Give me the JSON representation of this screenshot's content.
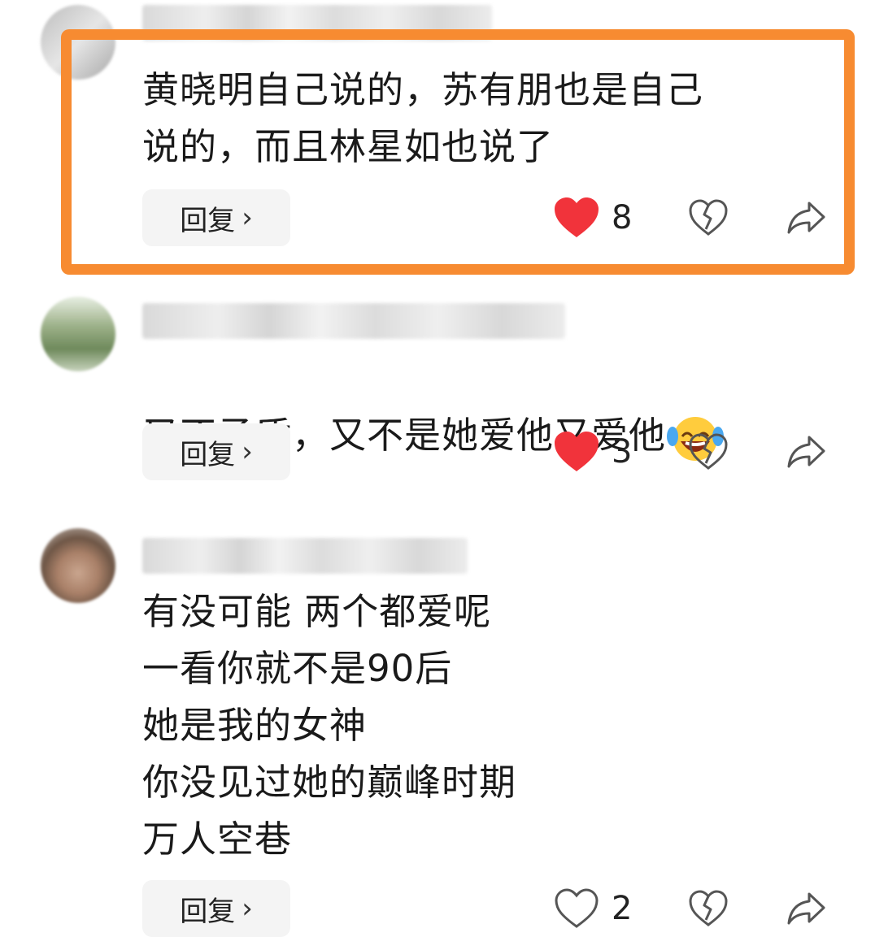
{
  "comments": [
    {
      "text": "黄晓明自己说的，苏有朋也是自己\n说的，而且林星如也说了",
      "reply_label": "回复",
      "like_count": "8",
      "liked": true
    },
    {
      "text": "又不矛盾，又不是她爱他又爱他",
      "emoji": "laughing-tears-emoji",
      "reply_label": "回复",
      "like_count": "3",
      "liked": true
    },
    {
      "text": "有没可能 两个都爱呢\n 一看你就不是90后\n她是我的女神\n你没见过她的巅峰时期\n万人空巷",
      "reply_label": "回复",
      "like_count": "2",
      "liked": false
    }
  ],
  "icons": {
    "like": "heart-icon",
    "dislike": "broken-heart-icon",
    "share": "share-arrow-icon",
    "reply_chevron": "chevron-right-icon"
  },
  "colors": {
    "highlight_border": "#f78b31",
    "liked_heart": "#f1333b",
    "icon_gray": "#555555",
    "reply_bg": "#f4f4f4"
  }
}
